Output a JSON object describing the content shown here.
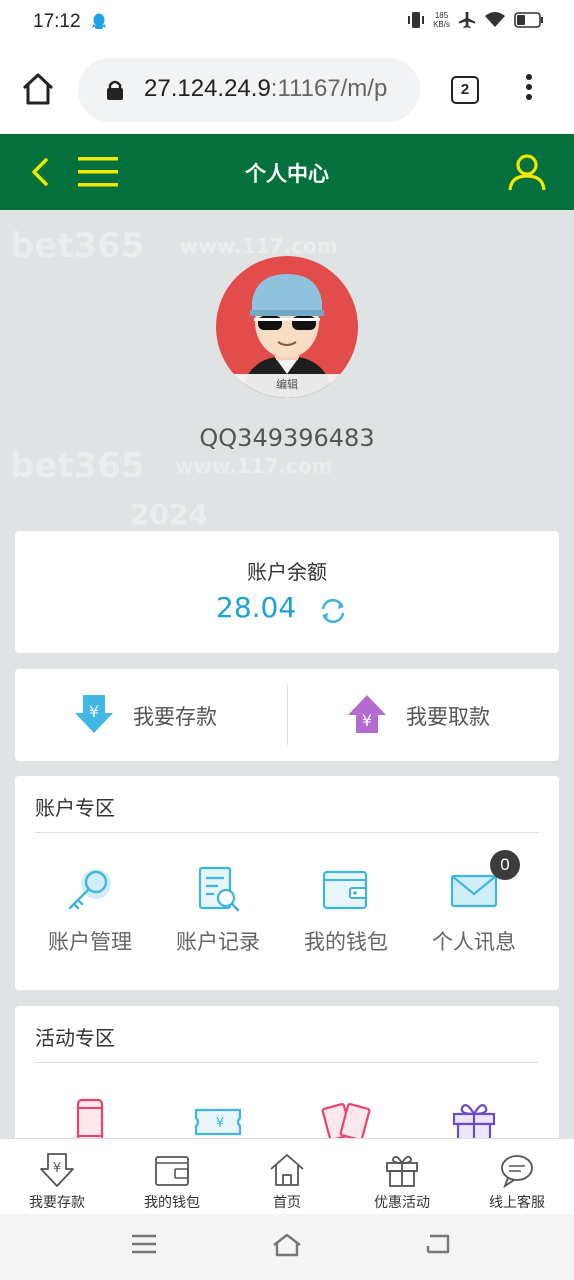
{
  "status_bar": {
    "time": "17:12",
    "net_speed_value": "185",
    "net_speed_unit": "KB/s"
  },
  "browser": {
    "url_host": "27.124.24.9",
    "url_rest": ":11167/m/p",
    "tab_count": "2"
  },
  "header": {
    "title": "个人中心"
  },
  "background_watermark": [
    "bet365",
    "www.117.com",
    "bet365",
    "www.117.com",
    "2024"
  ],
  "profile": {
    "edit_label": "编辑",
    "username": "QQ349396483"
  },
  "balance": {
    "label": "账户余额",
    "amount": "28.04"
  },
  "actions": {
    "deposit": "我要存款",
    "withdraw": "我要取款"
  },
  "account_section": {
    "title": "账户专区",
    "items": [
      {
        "label": "账户管理",
        "icon": "key-icon"
      },
      {
        "label": "账户记录",
        "icon": "record-search-icon"
      },
      {
        "label": "我的钱包",
        "icon": "wallet-icon"
      },
      {
        "label": "个人讯息",
        "icon": "mail-icon",
        "badge": "0"
      }
    ]
  },
  "activity_section": {
    "title": "活动专区",
    "items": [
      {
        "icon": "phone-icon"
      },
      {
        "icon": "ticket-icon"
      },
      {
        "icon": "red-envelope-icon"
      },
      {
        "icon": "gift-icon"
      }
    ]
  },
  "bottom_nav": [
    {
      "label": "我要存款",
      "icon": "deposit-icon"
    },
    {
      "label": "我的钱包",
      "icon": "wallet-icon"
    },
    {
      "label": "首页",
      "icon": "home-icon"
    },
    {
      "label": "优惠活动",
      "icon": "gift-icon"
    },
    {
      "label": "线上客服",
      "icon": "chat-icon"
    }
  ],
  "colors": {
    "header_green": "#04703d",
    "accent_yellow": "#f2e900",
    "amount_blue": "#1aa3d6",
    "avatar_red": "#e24c4b"
  }
}
